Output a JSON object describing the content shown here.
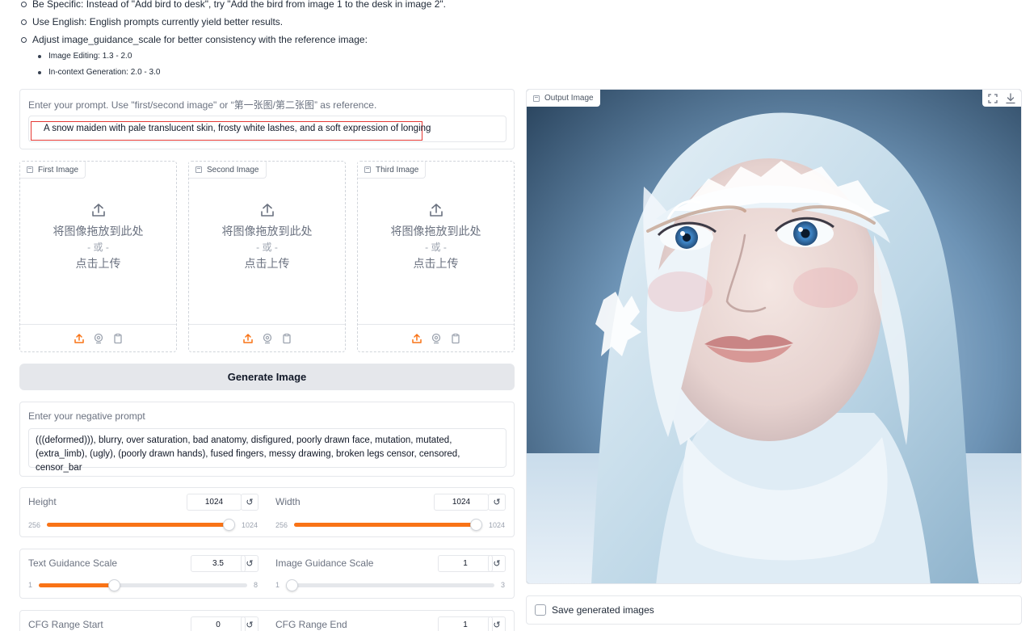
{
  "tips": {
    "items": [
      {
        "text": "Be Specific: Instead of \"Add bird to desk\", try \"Add the bird from image 1 to the desk in image 2\".",
        "level": 1
      },
      {
        "text": "Use English: English prompts currently yield better results.",
        "level": 1
      },
      {
        "text": "Adjust image_guidance_scale for better consistency with the reference image:",
        "level": 1
      },
      {
        "text": "Image Editing: 1.3 - 2.0",
        "level": 2
      },
      {
        "text": "In-context Generation: 2.0 - 3.0",
        "level": 2
      }
    ]
  },
  "prompt": {
    "label": "Enter your prompt. Use \"first/second image\" or “第一张图/第二张图” as reference.",
    "value": "A snow maiden with pale translucent skin, frosty white lashes, and a soft expression of longing"
  },
  "image_slots": [
    {
      "title": "First Image",
      "drop_text": "将图像拖放到此处",
      "or_text": "- 或 -",
      "click_text": "点击上传"
    },
    {
      "title": "Second Image",
      "drop_text": "将图像拖放到此处",
      "or_text": "- 或 -",
      "click_text": "点击上传"
    },
    {
      "title": "Third Image",
      "drop_text": "将图像拖放到此处",
      "or_text": "- 或 -",
      "click_text": "点击上传"
    }
  ],
  "generate_button": "Generate Image",
  "negative_prompt": {
    "label": "Enter your negative prompt",
    "value": "(((deformed))), blurry, over saturation, bad anatomy, disfigured, poorly drawn face, mutation, mutated, (extra_limb), (ugly), (poorly drawn hands), fused fingers, messy drawing, broken legs censor, censored, censor_bar"
  },
  "sliders": {
    "height": {
      "label": "Height",
      "value": "1024",
      "min": "256",
      "max": "1024",
      "fraction": 0.98
    },
    "width": {
      "label": "Width",
      "value": "1024",
      "min": "256",
      "max": "1024",
      "fraction": 0.98
    },
    "text_guidance": {
      "label": "Text Guidance Scale",
      "value": "3.5",
      "min": "1",
      "max": "8",
      "fraction": 0.36
    },
    "image_guidance": {
      "label": "Image Guidance Scale",
      "value": "1",
      "min": "1",
      "max": "3",
      "fraction": 0.0
    },
    "cfg_start": {
      "label": "CFG Range Start",
      "value": "0"
    },
    "cfg_end": {
      "label": "CFG Range End",
      "value": "1"
    }
  },
  "reset_glyph": "↺",
  "output": {
    "label": "Output Image",
    "tools": [
      "fullscreen-icon",
      "download-icon"
    ]
  },
  "save": {
    "label": "Save generated images",
    "checked": false
  },
  "colors": {
    "accent": "#f97316",
    "highlight_border": "#e53935",
    "button_bg": "#e5e7eb"
  }
}
